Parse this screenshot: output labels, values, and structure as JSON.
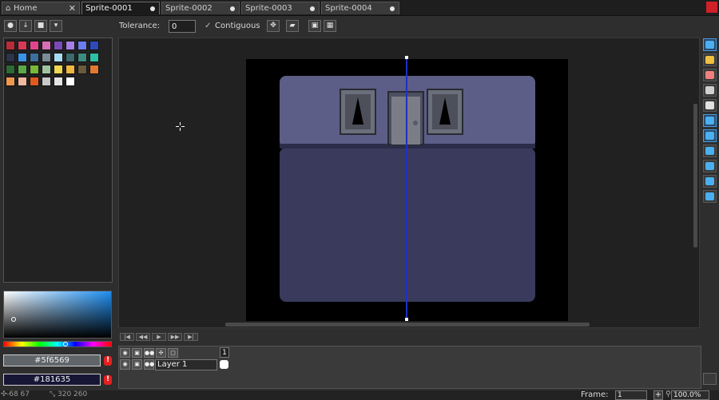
{
  "tabs": [
    {
      "label": "Home",
      "close": "✕"
    },
    {
      "label": "Sprite-0001"
    },
    {
      "label": "Sprite-0002"
    },
    {
      "label": "Sprite-0003"
    },
    {
      "label": "Sprite-0004"
    }
  ],
  "toolbar": {
    "tolerance_label": "Tolerance:",
    "tolerance_value": "0",
    "contiguous_check": "✓",
    "contiguous_label": "Contiguous"
  },
  "palette": {
    "colors": [
      "#b92d38",
      "#d83a56",
      "#e0468e",
      "#d86fb6",
      "#7a4bb6",
      "#a87ee8",
      "#6d7df0",
      "#2e4ab8",
      "#2b3448",
      "#3a94e6",
      "#3c6f9e",
      "#7a8c96",
      "#a6dcf2",
      "#3c6a6e",
      "#3c8c80",
      "#2ec0a6",
      "#2e6a34",
      "#5aa848",
      "#7ab838",
      "#a0c4a0",
      "#f0d850",
      "#f0b840",
      "#6a5a3a",
      "#e07a30",
      "#f09850",
      "#f0b8a0",
      "#e05a20",
      "#c8c8c8",
      "#e4e4e4",
      "#ffffff"
    ],
    "primary_color": "#5f6569",
    "secondary_color": "#181635",
    "primary_hex": "#5f6569",
    "secondary_hex": "#181635",
    "warning_glyph": "!"
  },
  "tools": [
    {
      "name": "rectangular-marquee-icon",
      "color": "#4ab0f0",
      "active": true
    },
    {
      "name": "pencil-icon",
      "color": "#f0c040"
    },
    {
      "name": "eraser-icon",
      "color": "#f08080"
    },
    {
      "name": "eyedropper-icon",
      "color": "#d0d0d0"
    },
    {
      "name": "zoom-icon",
      "color": "#e0e0e0"
    },
    {
      "name": "move-icon",
      "color": "#4ab0f0",
      "active": true
    },
    {
      "name": "paint-bucket-icon",
      "color": "#4ab0f0",
      "active": true
    },
    {
      "name": "line-icon",
      "color": "#4ab0f0"
    },
    {
      "name": "rectangle-icon",
      "color": "#4ab0f0"
    },
    {
      "name": "lasso-icon",
      "color": "#4ab0f0"
    },
    {
      "name": "blur-icon",
      "color": "#4ab0f0"
    }
  ],
  "sprite": {
    "background": "#000000",
    "wall": "#5c5e87",
    "floor": "#393a5c",
    "window_frame": "#6a6f7c",
    "door": "#7a7d86",
    "guide_color": "#2030c0"
  },
  "timeline": {
    "frame_number": "1",
    "layer_name": "Layer 1",
    "nav_buttons": [
      "|◀",
      "◀◀",
      "▶",
      "▶▶",
      "▶|"
    ]
  },
  "status": {
    "cursor_pos": "-68 67",
    "sprite_size": "320 260",
    "frame_label": "Frame:",
    "frame_value": "1",
    "add_frame": "+",
    "zoom_value": "100.0%"
  }
}
